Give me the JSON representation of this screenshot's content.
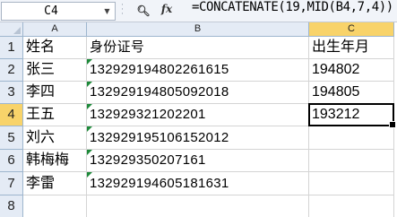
{
  "formula_bar": {
    "name_box": "C4",
    "zoom_icon": "magnifier-icon",
    "fx_label": "fx",
    "formula": "=CONCATENATE(19,MID(B4,7,4))"
  },
  "sheet": {
    "columns": [
      "A",
      "B",
      "C"
    ],
    "active_column": "C",
    "active_row": "4",
    "rows": [
      {
        "num": "1",
        "a": "姓名",
        "b": "身份证号",
        "c": "出生年月",
        "b_marker": false
      },
      {
        "num": "2",
        "a": "张三",
        "b": "132929194802261615",
        "c": "194802",
        "b_marker": true
      },
      {
        "num": "3",
        "a": "李四",
        "b": "132929194805092018",
        "c": "194805",
        "b_marker": true
      },
      {
        "num": "4",
        "a": "王五",
        "b": "132929321202201",
        "c": "193212",
        "b_marker": true
      },
      {
        "num": "5",
        "a": "刘六",
        "b": "132929195106152012",
        "c": "",
        "b_marker": true
      },
      {
        "num": "6",
        "a": "韩梅梅",
        "b": "132929350207161",
        "c": "",
        "b_marker": true
      },
      {
        "num": "7",
        "a": "李雷",
        "b": "132929194605181631",
        "c": "",
        "b_marker": true
      },
      {
        "num": "8",
        "a": "",
        "b": "",
        "c": "",
        "b_marker": false
      }
    ],
    "colors": {
      "header_bg": "#e4ebf5",
      "active_header": "#f8d36a",
      "marker": "#1e8a3a"
    }
  }
}
